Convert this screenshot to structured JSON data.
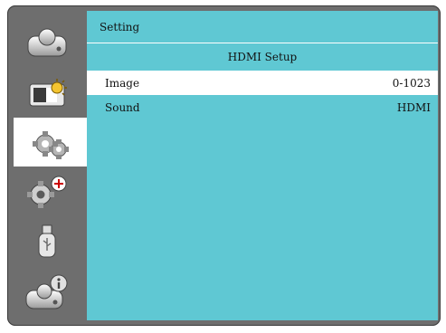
{
  "nav": {
    "items": [
      {
        "icon": "display-settings-icon"
      },
      {
        "icon": "image-adjust-icon"
      },
      {
        "icon": "setting-gears-icon",
        "active": true
      },
      {
        "icon": "expanded-setting-icon"
      },
      {
        "icon": "usb-icon"
      },
      {
        "icon": "information-icon"
      }
    ]
  },
  "panel": {
    "title": "Setting",
    "section": "HDMI Setup",
    "rows": [
      {
        "label": "Image",
        "value": "0-1023",
        "selected": true
      },
      {
        "label": "Sound",
        "value": "HDMI",
        "selected": false
      }
    ]
  },
  "colors": {
    "panel_bg": "#5fc8d3",
    "frame_bg": "#6e6e6e",
    "selected_bg": "#ffffff"
  }
}
